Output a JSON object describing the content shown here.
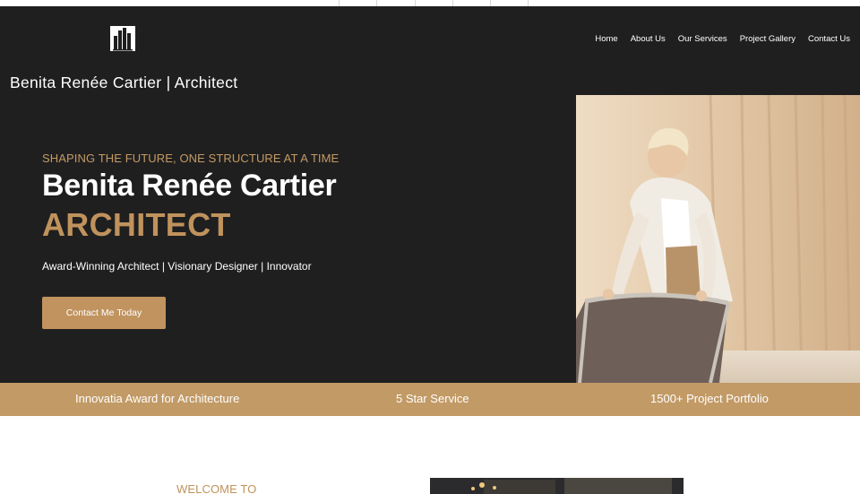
{
  "header": {
    "logo_icon": "building-logo-icon",
    "site_title": "Benita Renée Cartier | Architect",
    "nav": [
      "Home",
      "About Us",
      "Our Services",
      "Project Gallery",
      "Contact Us"
    ]
  },
  "hero": {
    "tagline": "SHAPING THE FUTURE, ONE STRUCTURE AT A TIME",
    "name": "Benita Renée Cartier",
    "role": "ARCHITECT",
    "subtitle": "Award-Winning Architect | Visionary Designer | Innovator",
    "cta_label": "Contact Me Today"
  },
  "highlights": [
    "Innovatia Award for Architecture",
    "5 Star Service",
    "1500+ Project Portfolio"
  ],
  "welcome": {
    "heading": "WELCOME TO"
  },
  "colors": {
    "dark_bg": "#1f1f20",
    "accent_gold": "#c0925c",
    "band_gold": "#c29a66"
  }
}
